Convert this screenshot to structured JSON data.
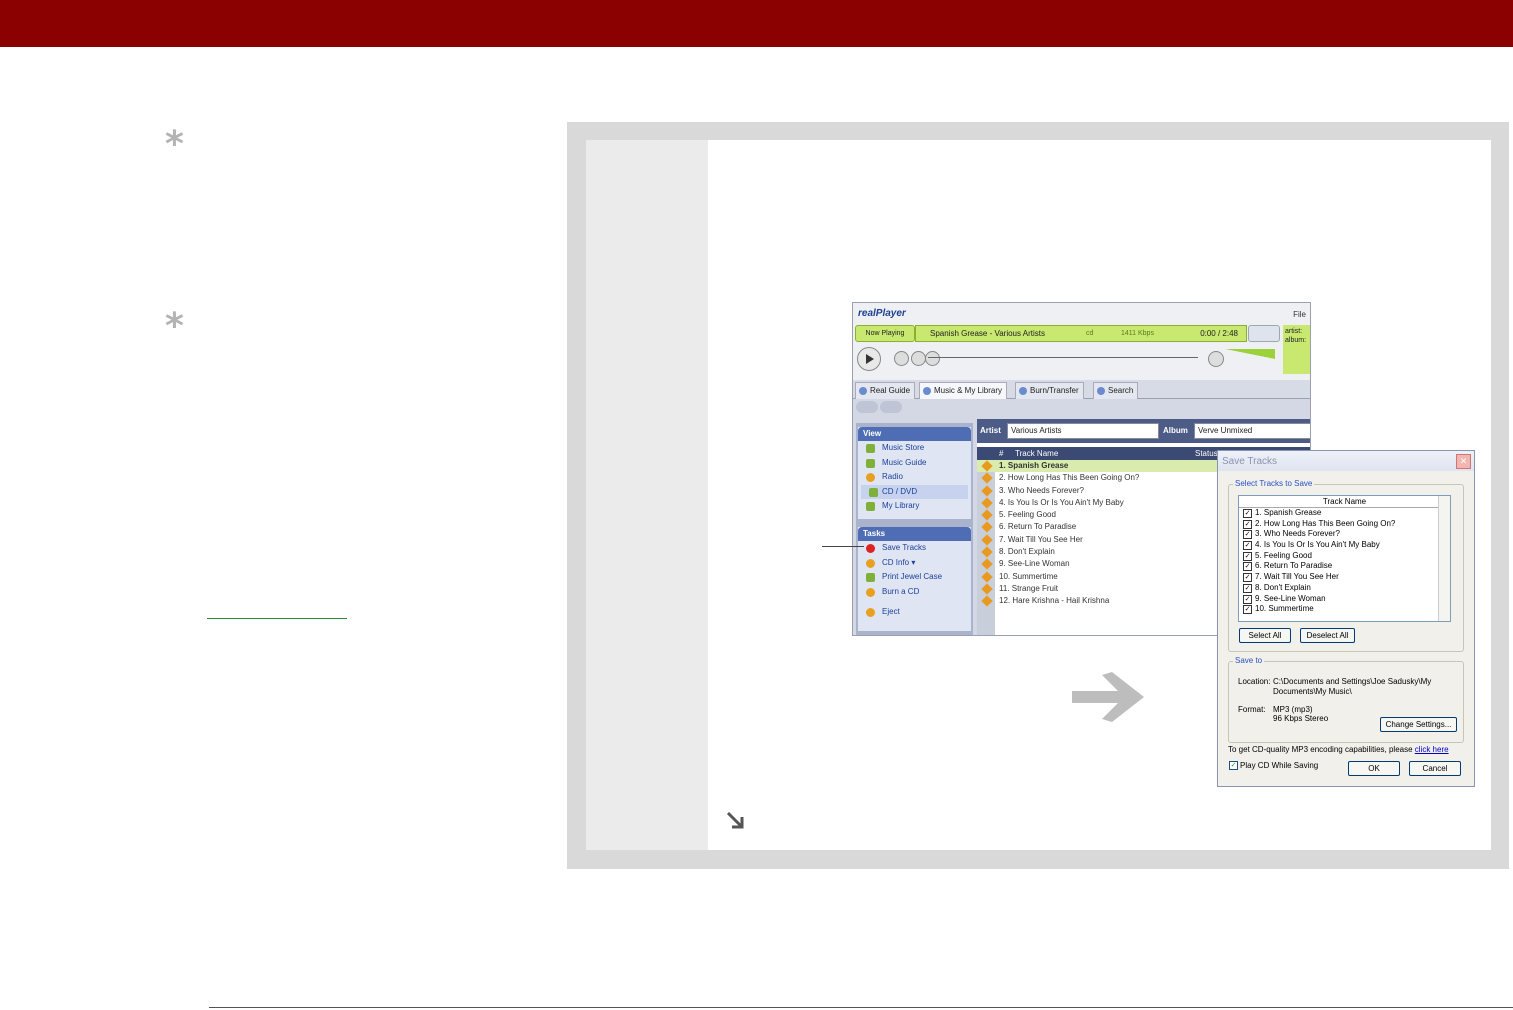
{
  "realplayer": {
    "logo": "realPlayer",
    "file_menu": "File",
    "now_playing_btn": "Now Playing",
    "now_playing_title": "Spanish Grease - Various Artists",
    "cd_tag": "cd",
    "bitrate": "1411 Kbps",
    "time": "0:00 / 2:48",
    "info_text": "artist: album:",
    "tabs": [
      "Real Guide",
      "Music & My Library",
      "Burn/Transfer",
      "Search"
    ],
    "view_header": "View",
    "view_items": [
      "Music Store",
      "Music Guide",
      "Radio",
      "CD / DVD",
      "My Library"
    ],
    "tasks_header": "Tasks",
    "task_items": [
      "Save Tracks",
      "CD Info",
      "Print Jewel Case",
      "Burn a CD",
      "Eject"
    ],
    "artist_label": "Artist",
    "artist_value": "Various Artists",
    "album_label": "Album",
    "album_value": "Verve Unmixed",
    "col_num": "#",
    "col_track": "Track Name",
    "col_status": "Status",
    "tracks": [
      "1.  Spanish Grease",
      "2.  How Long Has This Been Going On?",
      "3.  Who Needs Forever?",
      "4.  Is You Is Or Is You Ain't My Baby",
      "5.  Feeling Good",
      "6.  Return To Paradise",
      "7.  Wait Till You See Her",
      "8.  Don't Explain",
      "9.  See-Line Woman",
      "10. Summertime",
      "11. Strange Fruit",
      "12. Hare Krishna - Hail Krishna"
    ]
  },
  "dialog": {
    "title": "Save Tracks",
    "select_group": "Select Tracks to Save",
    "list_header": "Track Name",
    "list_items": [
      "1. Spanish Grease",
      "2. How Long Has This Been Going On?",
      "3. Who Needs Forever?",
      "4. Is You Is Or Is You Ain't My Baby",
      "5. Feeling Good",
      "6. Return To Paradise",
      "7. Wait Till You See Her",
      "8. Don't Explain",
      "9. See-Line Woman",
      "10. Summertime"
    ],
    "select_all": "Select All",
    "deselect_all": "Deselect All",
    "save_to_group": "Save to",
    "location_label": "Location:",
    "location_value_1": "C:\\Documents and Settings\\Joe Sadusky\\My",
    "location_value_2": "Documents\\My Music\\",
    "format_label": "Format:",
    "format_value_1": "MP3 (mp3)",
    "format_value_2": "96 Kbps Stereo",
    "change_settings": "Change Settings...",
    "mp3_note": "To get CD-quality MP3 encoding capabilities, please",
    "click_here": "click here",
    "play_cd": "Play CD While Saving",
    "ok": "OK",
    "cancel": "Cancel"
  },
  "colors": {
    "header_bar": "#8b0000",
    "panel_gray": "#d9d9d9",
    "accent_green": "#c8e870"
  }
}
